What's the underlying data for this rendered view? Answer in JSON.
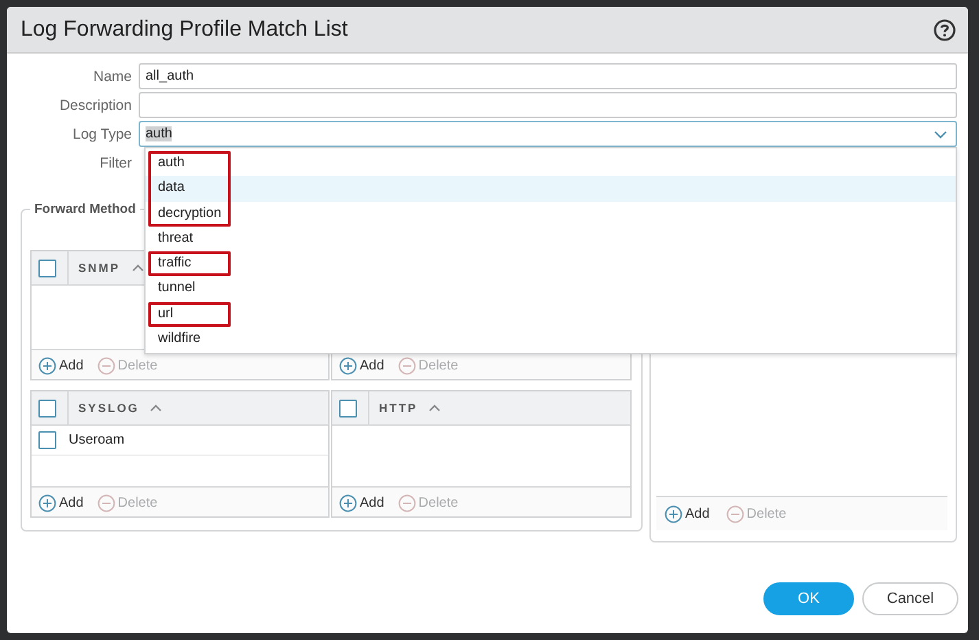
{
  "dialog": {
    "title": "Log Forwarding Profile Match List"
  },
  "form": [
    {
      "label": "Name",
      "kind": "text",
      "value": "all_auth",
      "text_selected": false
    },
    {
      "label": "Description",
      "kind": "text"
    },
    {
      "label": "Log Type",
      "kind": "select",
      "value": "auth",
      "text_selected": true
    },
    {
      "label": "Filter",
      "kind": "covered"
    }
  ],
  "log_type_dropdown": {
    "groups": [
      {
        "marked": true,
        "options": [
          {
            "label": "auth",
            "hovered": false
          },
          {
            "label": "data",
            "hovered": true
          },
          {
            "label": "decryption",
            "hovered": false
          }
        ]
      },
      {
        "marked": false,
        "options": [
          {
            "label": "threat",
            "hovered": false
          }
        ]
      },
      {
        "marked": true,
        "options": [
          {
            "label": "traffic",
            "hovered": false
          }
        ]
      },
      {
        "marked": false,
        "options": [
          {
            "label": "tunnel",
            "hovered": false
          }
        ]
      },
      {
        "marked": true,
        "options": [
          {
            "label": "url",
            "hovered": false
          }
        ]
      },
      {
        "marked": false,
        "options": [
          {
            "label": "wildfire",
            "hovered": false
          }
        ]
      }
    ]
  },
  "forward_method": {
    "legend": "Forward Method",
    "panels": [
      {
        "title": "SNMP",
        "select_all_checked": false,
        "actions": [
          {
            "label": "Add",
            "disabled": false
          },
          {
            "label": "Delete",
            "disabled": true
          }
        ]
      },
      {
        "actions": [
          {
            "label": "Add",
            "disabled": false
          },
          {
            "label": "Delete",
            "disabled": true
          }
        ]
      },
      {
        "title": "SYSLOG",
        "select_all_checked": false,
        "rows": [
          {
            "name": "Useroam",
            "checked": false
          }
        ],
        "actions": [
          {
            "label": "Add",
            "disabled": false
          },
          {
            "label": "Delete",
            "disabled": true
          }
        ]
      },
      {
        "title": "HTTP",
        "select_all_checked": false,
        "actions": [
          {
            "label": "Add",
            "disabled": false
          },
          {
            "label": "Delete",
            "disabled": true
          }
        ]
      }
    ]
  },
  "right_panel": {
    "actions": [
      {
        "label": "Add",
        "disabled": false
      },
      {
        "label": "Delete",
        "disabled": true
      }
    ]
  },
  "buttons": [
    {
      "label": "OK",
      "kind": "primary"
    },
    {
      "label": "Cancel",
      "kind": "secondary"
    }
  ]
}
